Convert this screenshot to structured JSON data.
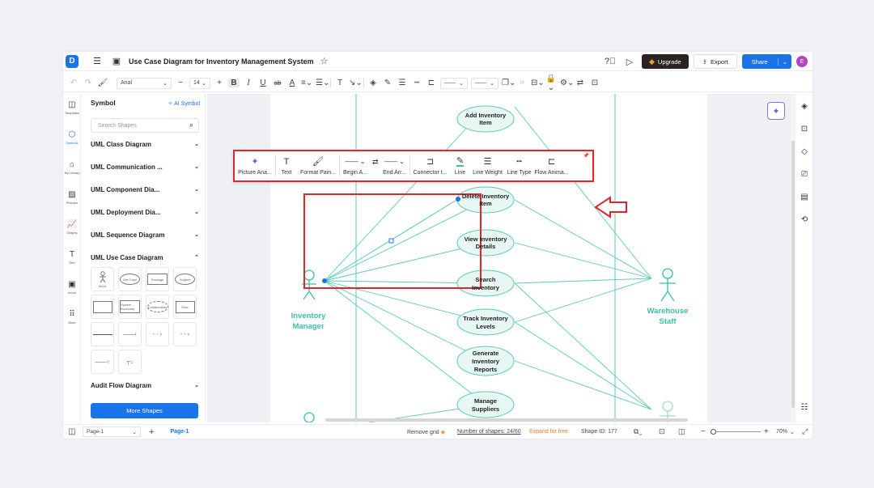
{
  "window": {
    "title": "Use Case Diagram for Inventory Management System"
  },
  "titlebar": {
    "upgrade_label": "Upgrade",
    "export_label": "Export",
    "share_label": "Share",
    "avatar_letter": "E"
  },
  "formatbar": {
    "font": "Arial",
    "font_size": "14"
  },
  "rail": {
    "items": [
      {
        "label": "Templates"
      },
      {
        "label": "Symbols"
      },
      {
        "label": "My Library"
      },
      {
        "label": "Pictures"
      },
      {
        "label": "Graphs"
      },
      {
        "label": "Text"
      },
      {
        "label": "Icons"
      },
      {
        "label": "More"
      }
    ]
  },
  "panel": {
    "title": "Symbol",
    "ai_symbol": "AI Symbol",
    "search_placeholder": "Search Shapes",
    "categories": [
      {
        "label": "UML Class Diagram"
      },
      {
        "label": "UML Communication ..."
      },
      {
        "label": "UML Component Dia..."
      },
      {
        "label": "UML Deployment Dia..."
      },
      {
        "label": "UML Sequence Diagram"
      },
      {
        "label": "UML Use Case Diagram"
      },
      {
        "label": "Audit Flow Diagram"
      }
    ],
    "shape_labels": {
      "actor": "Actor",
      "use_case": "Use Case",
      "package": "Package",
      "subject": "Subject",
      "system_boundary": "System Boundary",
      "collaboration": "Collaboration",
      "note": "Note"
    },
    "more_shapes": "More Shapes"
  },
  "floatbar": {
    "items": [
      {
        "label": "Picture Ana..."
      },
      {
        "label": "Text"
      },
      {
        "label": "Format Pain..."
      },
      {
        "label": "Begin A..."
      },
      {
        "label": "End Arr..."
      },
      {
        "label": "Connector t..."
      },
      {
        "label": "Line"
      },
      {
        "label": "Line Weight"
      },
      {
        "label": "Line Type"
      },
      {
        "label": "Flow Anima..."
      }
    ]
  },
  "diagram": {
    "actors": {
      "inventory_manager": "Inventory\nManager",
      "warehouse_staff": "Warehouse\nStaff"
    },
    "use_cases": {
      "add": "Add Inventory\nItem",
      "delete": "Delete Inventory\nItem",
      "view": "View Inventory\nDetails",
      "search": "Search\nInventory",
      "track": "Track Inventory\nLevels",
      "generate": "Generate\nInventory\nReports",
      "suppliers": "Manage\nSuppliers"
    },
    "colors": {
      "line": "#5cc9b8",
      "actor": "#3bbfa8",
      "usecase_fill": "#e6f7f4",
      "highlight": "#e0262b",
      "handle": "#1a73e8"
    }
  },
  "statusbar": {
    "page_select": "Page-1",
    "page_tab": "Page-1",
    "remove_grid": "Remove grid",
    "shape_count": "Number of shapes: 24/60",
    "expand": "Expand for free",
    "shape_id": "Shape ID: 177",
    "zoom": "70%"
  }
}
